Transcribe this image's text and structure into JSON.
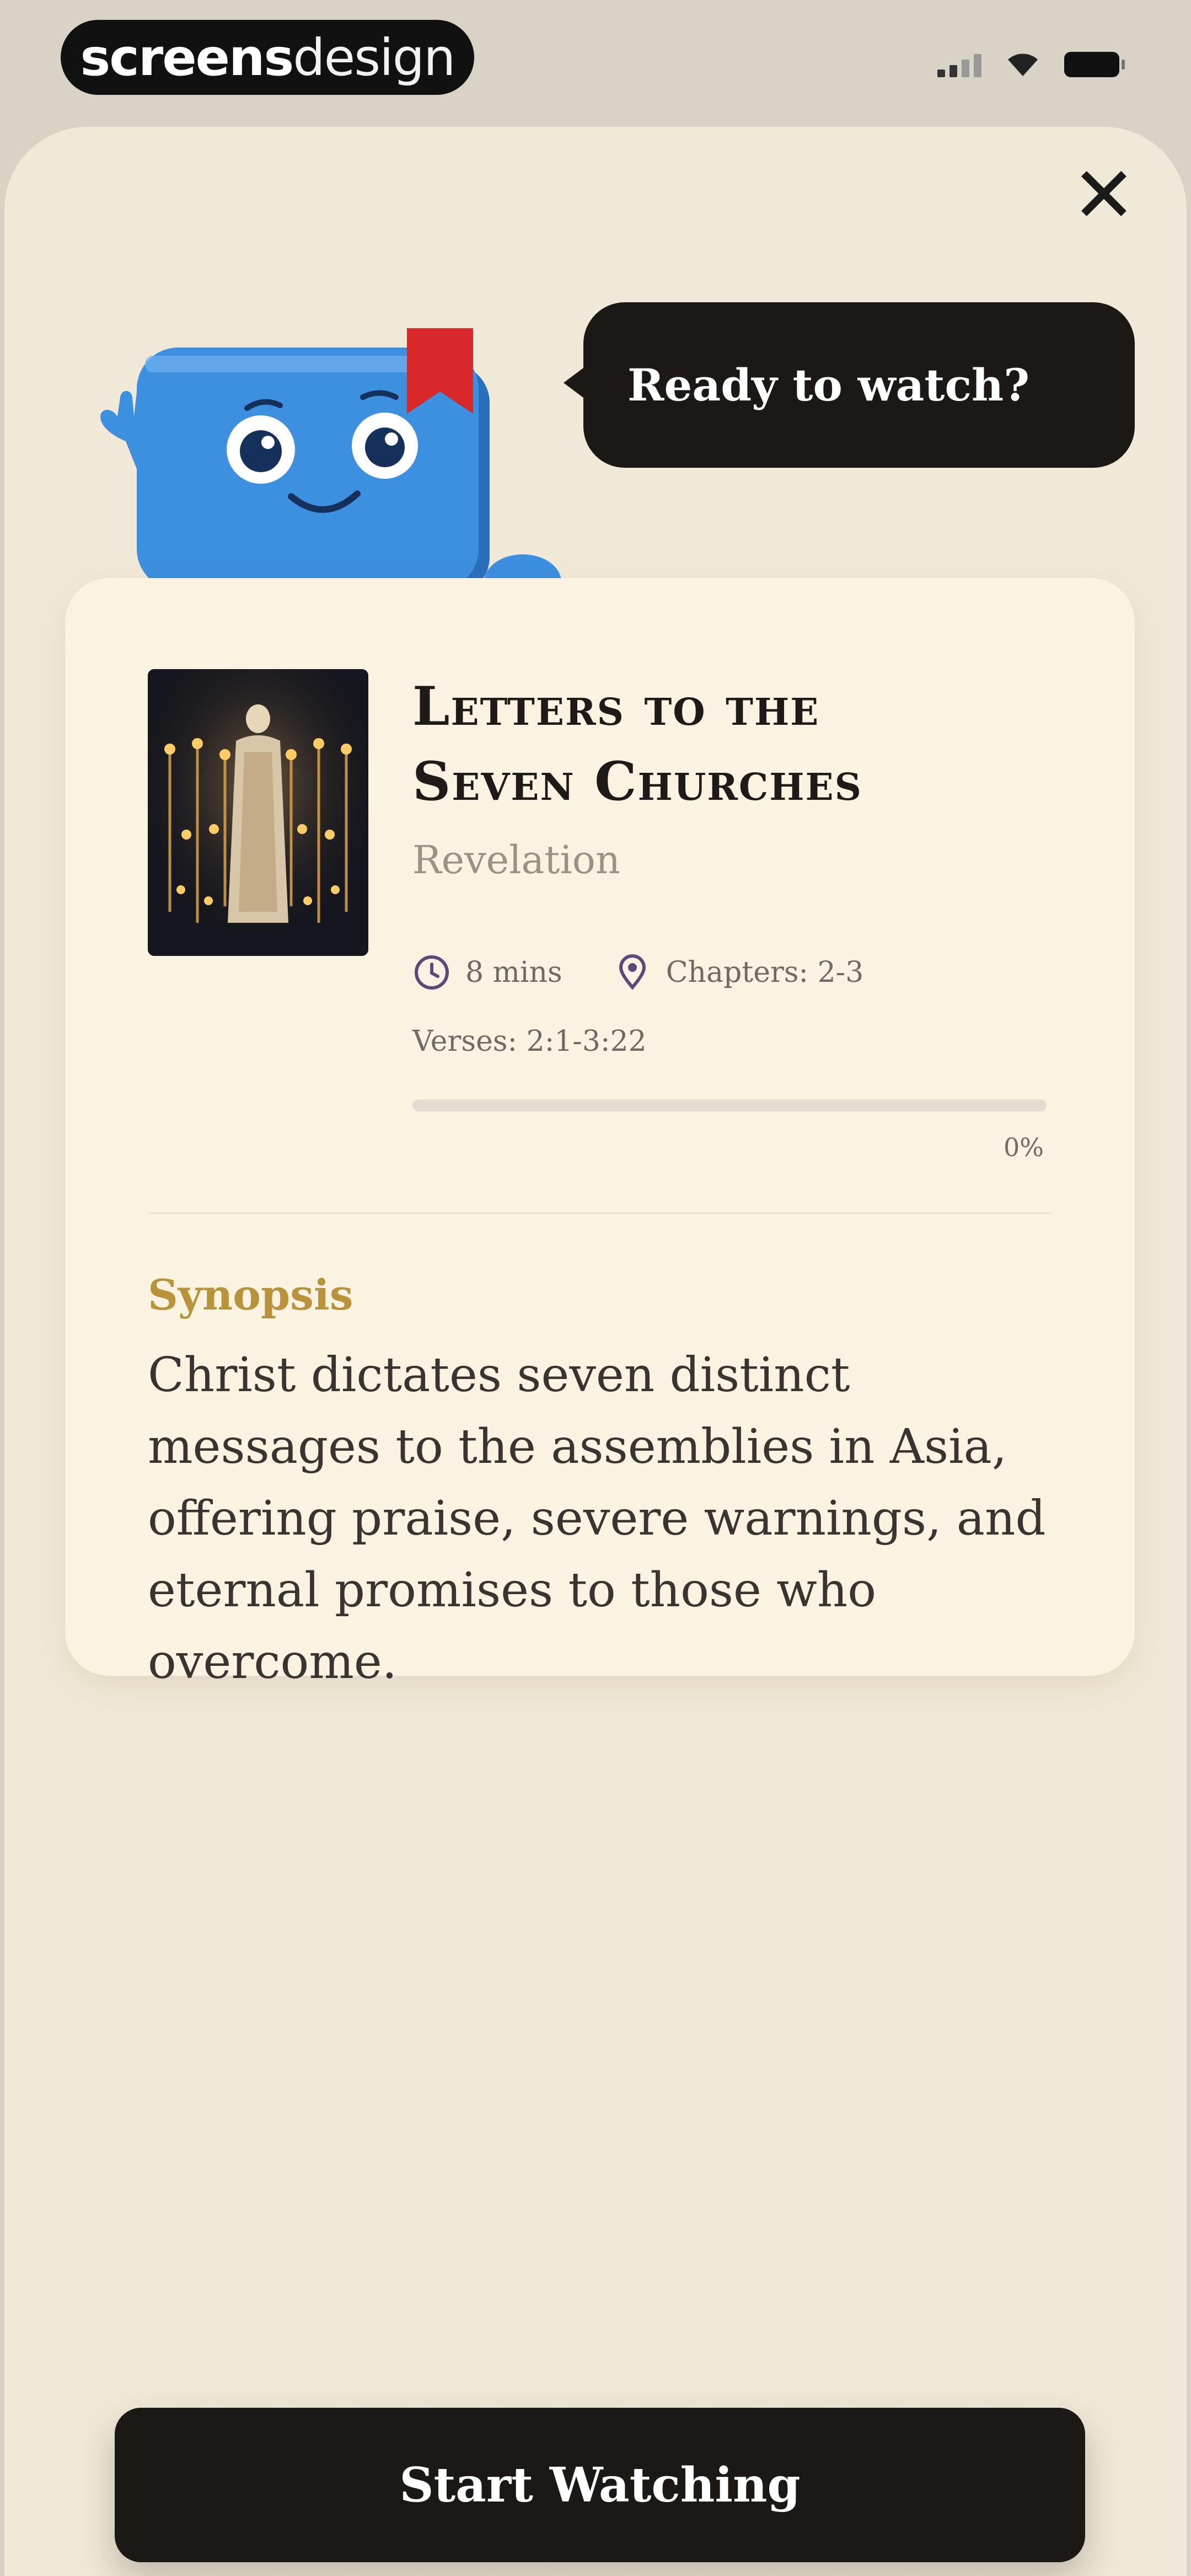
{
  "status_bar": {
    "brand_bold": "screens",
    "brand_light": "design"
  },
  "sheet": {
    "close_icon": "close-icon",
    "bubble_text": "Ready to watch?",
    "mascot": "book-mascot-illustration"
  },
  "card": {
    "title_line1": "Letters to the",
    "title_line2": "Seven Churches",
    "book": "Revelation",
    "duration": "8 mins",
    "chapters": "Chapters: 2-3",
    "verses": "Verses: 2:1-3:22",
    "progress_fraction": 0,
    "progress_label": "0%",
    "synopsis_heading": "Synopsis",
    "synopsis_text": "Christ dictates seven distinct messages to the assemblies in Asia, offering praise, severe warnings, and eternal promises to those who overcome."
  },
  "cta": {
    "label": "Start Watching"
  },
  "colors": {
    "background": "#f1e9d8",
    "card": "#faf3e1",
    "dark": "#1c1816",
    "accent_gold": "#b9933a",
    "mascot_blue": "#3d8fe0",
    "bookmark_red": "#d8282a"
  }
}
